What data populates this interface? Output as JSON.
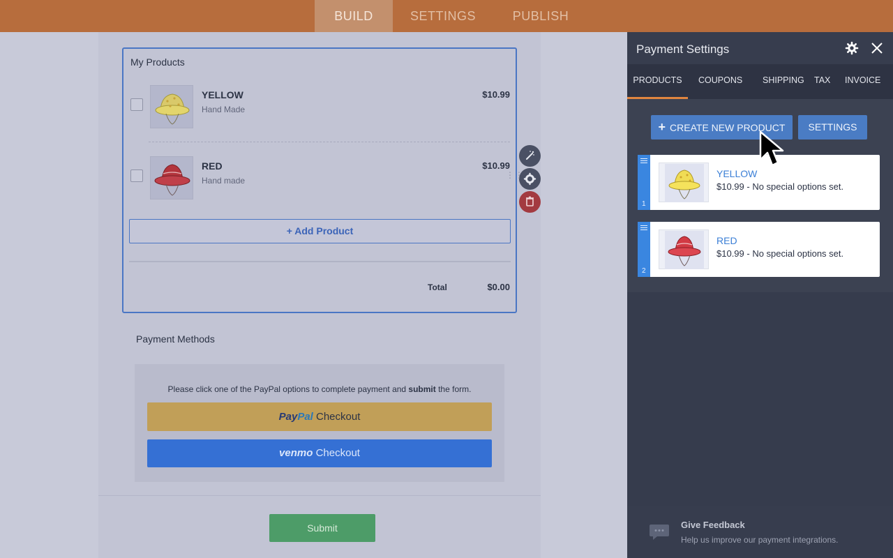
{
  "topnav": {
    "tabs": [
      "BUILD",
      "SETTINGS",
      "PUBLISH"
    ],
    "active": "BUILD"
  },
  "form": {
    "products_title": "My Products",
    "products": [
      {
        "name": "YELLOW",
        "subtitle": "Hand Made",
        "price": "$10.99",
        "icon": "yellow-bucket-hat"
      },
      {
        "name": "RED",
        "subtitle": "Hand made",
        "price": "$10.99",
        "icon": "red-bucket-hat"
      }
    ],
    "add_product_label": "+ Add Product",
    "total_label": "Total",
    "total_value": "$0.00",
    "payment_methods_title": "Payment Methods",
    "payment_note_before": "Please click one of the PayPal options to complete payment and ",
    "payment_note_bold": "submit",
    "payment_note_after": " the form.",
    "paypal_brand_a": "Pay",
    "paypal_brand_b": "Pal",
    "paypal_checkout": "Checkout",
    "venmo_brand": "venmo",
    "venmo_checkout": "Checkout",
    "submit_label": "Submit"
  },
  "panel": {
    "title": "Payment Settings",
    "tabs": [
      "PRODUCTS",
      "COUPONS",
      "SHIPPING",
      "TAX",
      "INVOICE"
    ],
    "active_tab": "PRODUCTS",
    "create_label": "CREATE NEW PRODUCT",
    "settings_label": "SETTINGS",
    "items": [
      {
        "number": "1",
        "name": "YELLOW",
        "description": "$10.99 - No special options set."
      },
      {
        "number": "2",
        "name": "RED",
        "description": "$10.99 - No special options set."
      }
    ],
    "feedback_title": "Give Feedback",
    "feedback_sub": "Help us improve our payment integrations."
  },
  "colors": {
    "accent_orange": "#e0853f",
    "primary_blue": "#4a7cc4",
    "danger_red": "#a33a40",
    "submit_green": "#4d9c68"
  }
}
